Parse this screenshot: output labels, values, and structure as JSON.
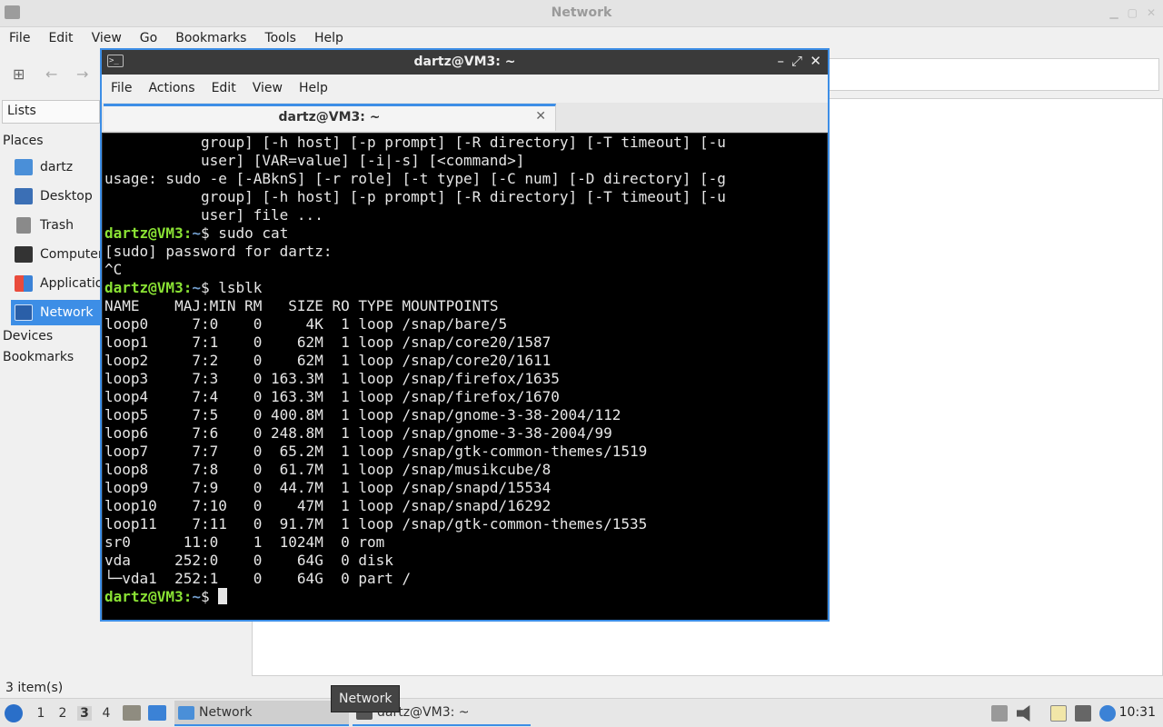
{
  "file_manager": {
    "title": "Network",
    "menu": [
      "File",
      "Edit",
      "View",
      "Go",
      "Bookmarks",
      "Tools",
      "Help"
    ],
    "sidebar_mode": "Lists",
    "sections": {
      "places": "Places",
      "devices": "Devices",
      "bookmarks": "Bookmarks"
    },
    "places": [
      {
        "label": "dartz",
        "icon": "home-folder-icon"
      },
      {
        "label": "Desktop",
        "icon": "desktop-folder-icon"
      },
      {
        "label": "Trash",
        "icon": "trash-icon"
      },
      {
        "label": "Computer",
        "icon": "computer-icon"
      },
      {
        "label": "Applications",
        "icon": "applications-icon"
      },
      {
        "label": "Network",
        "icon": "network-icon"
      }
    ],
    "status": "3 item(s)"
  },
  "terminal": {
    "title": "dartz@VM3: ~",
    "menu": [
      "File",
      "Actions",
      "Edit",
      "View",
      "Help"
    ],
    "tab_label": "dartz@VM3: ~",
    "prompt_user": "dartz@VM3",
    "prompt_path": "~",
    "lines": [
      "           group] [-h host] [-p prompt] [-R directory] [-T timeout] [-u",
      "           user] [VAR=value] [-i|-s] [<command>]",
      "usage: sudo -e [-ABknS] [-r role] [-t type] [-C num] [-D directory] [-g",
      "           group] [-h host] [-p prompt] [-R directory] [-T timeout] [-u",
      "           user] file ...",
      "$prompt$ sudo cat",
      "[sudo] password for dartz:",
      "^C",
      "$prompt$ lsblk",
      "NAME    MAJ:MIN RM   SIZE RO TYPE MOUNTPOINTS",
      "loop0     7:0    0     4K  1 loop /snap/bare/5",
      "loop1     7:1    0    62M  1 loop /snap/core20/1587",
      "loop2     7:2    0    62M  1 loop /snap/core20/1611",
      "loop3     7:3    0 163.3M  1 loop /snap/firefox/1635",
      "loop4     7:4    0 163.3M  1 loop /snap/firefox/1670",
      "loop5     7:5    0 400.8M  1 loop /snap/gnome-3-38-2004/112",
      "loop6     7:6    0 248.8M  1 loop /snap/gnome-3-38-2004/99",
      "loop7     7:7    0  65.2M  1 loop /snap/gtk-common-themes/1519",
      "loop8     7:8    0  61.7M  1 loop /snap/musikcube/8",
      "loop9     7:9    0  44.7M  1 loop /snap/snapd/15534",
      "loop10    7:10   0    47M  1 loop /snap/snapd/16292",
      "loop11    7:11   0  91.7M  1 loop /snap/gtk-common-themes/1535",
      "sr0      11:0    1  1024M  0 rom",
      "vda     252:0    0    64G  0 disk",
      "└─vda1  252:1    0    64G  0 part /",
      "$prompt$ $cursor$"
    ]
  },
  "tooltip": "Network",
  "taskbar": {
    "workspaces": [
      "1",
      "2",
      "3",
      "4"
    ],
    "active_workspace": "3",
    "tasks": [
      {
        "label": "Network",
        "icon": "folder-icon"
      },
      {
        "label": "dartz@VM3: ~",
        "icon": "terminal-icon"
      }
    ],
    "clock": "10:31"
  }
}
